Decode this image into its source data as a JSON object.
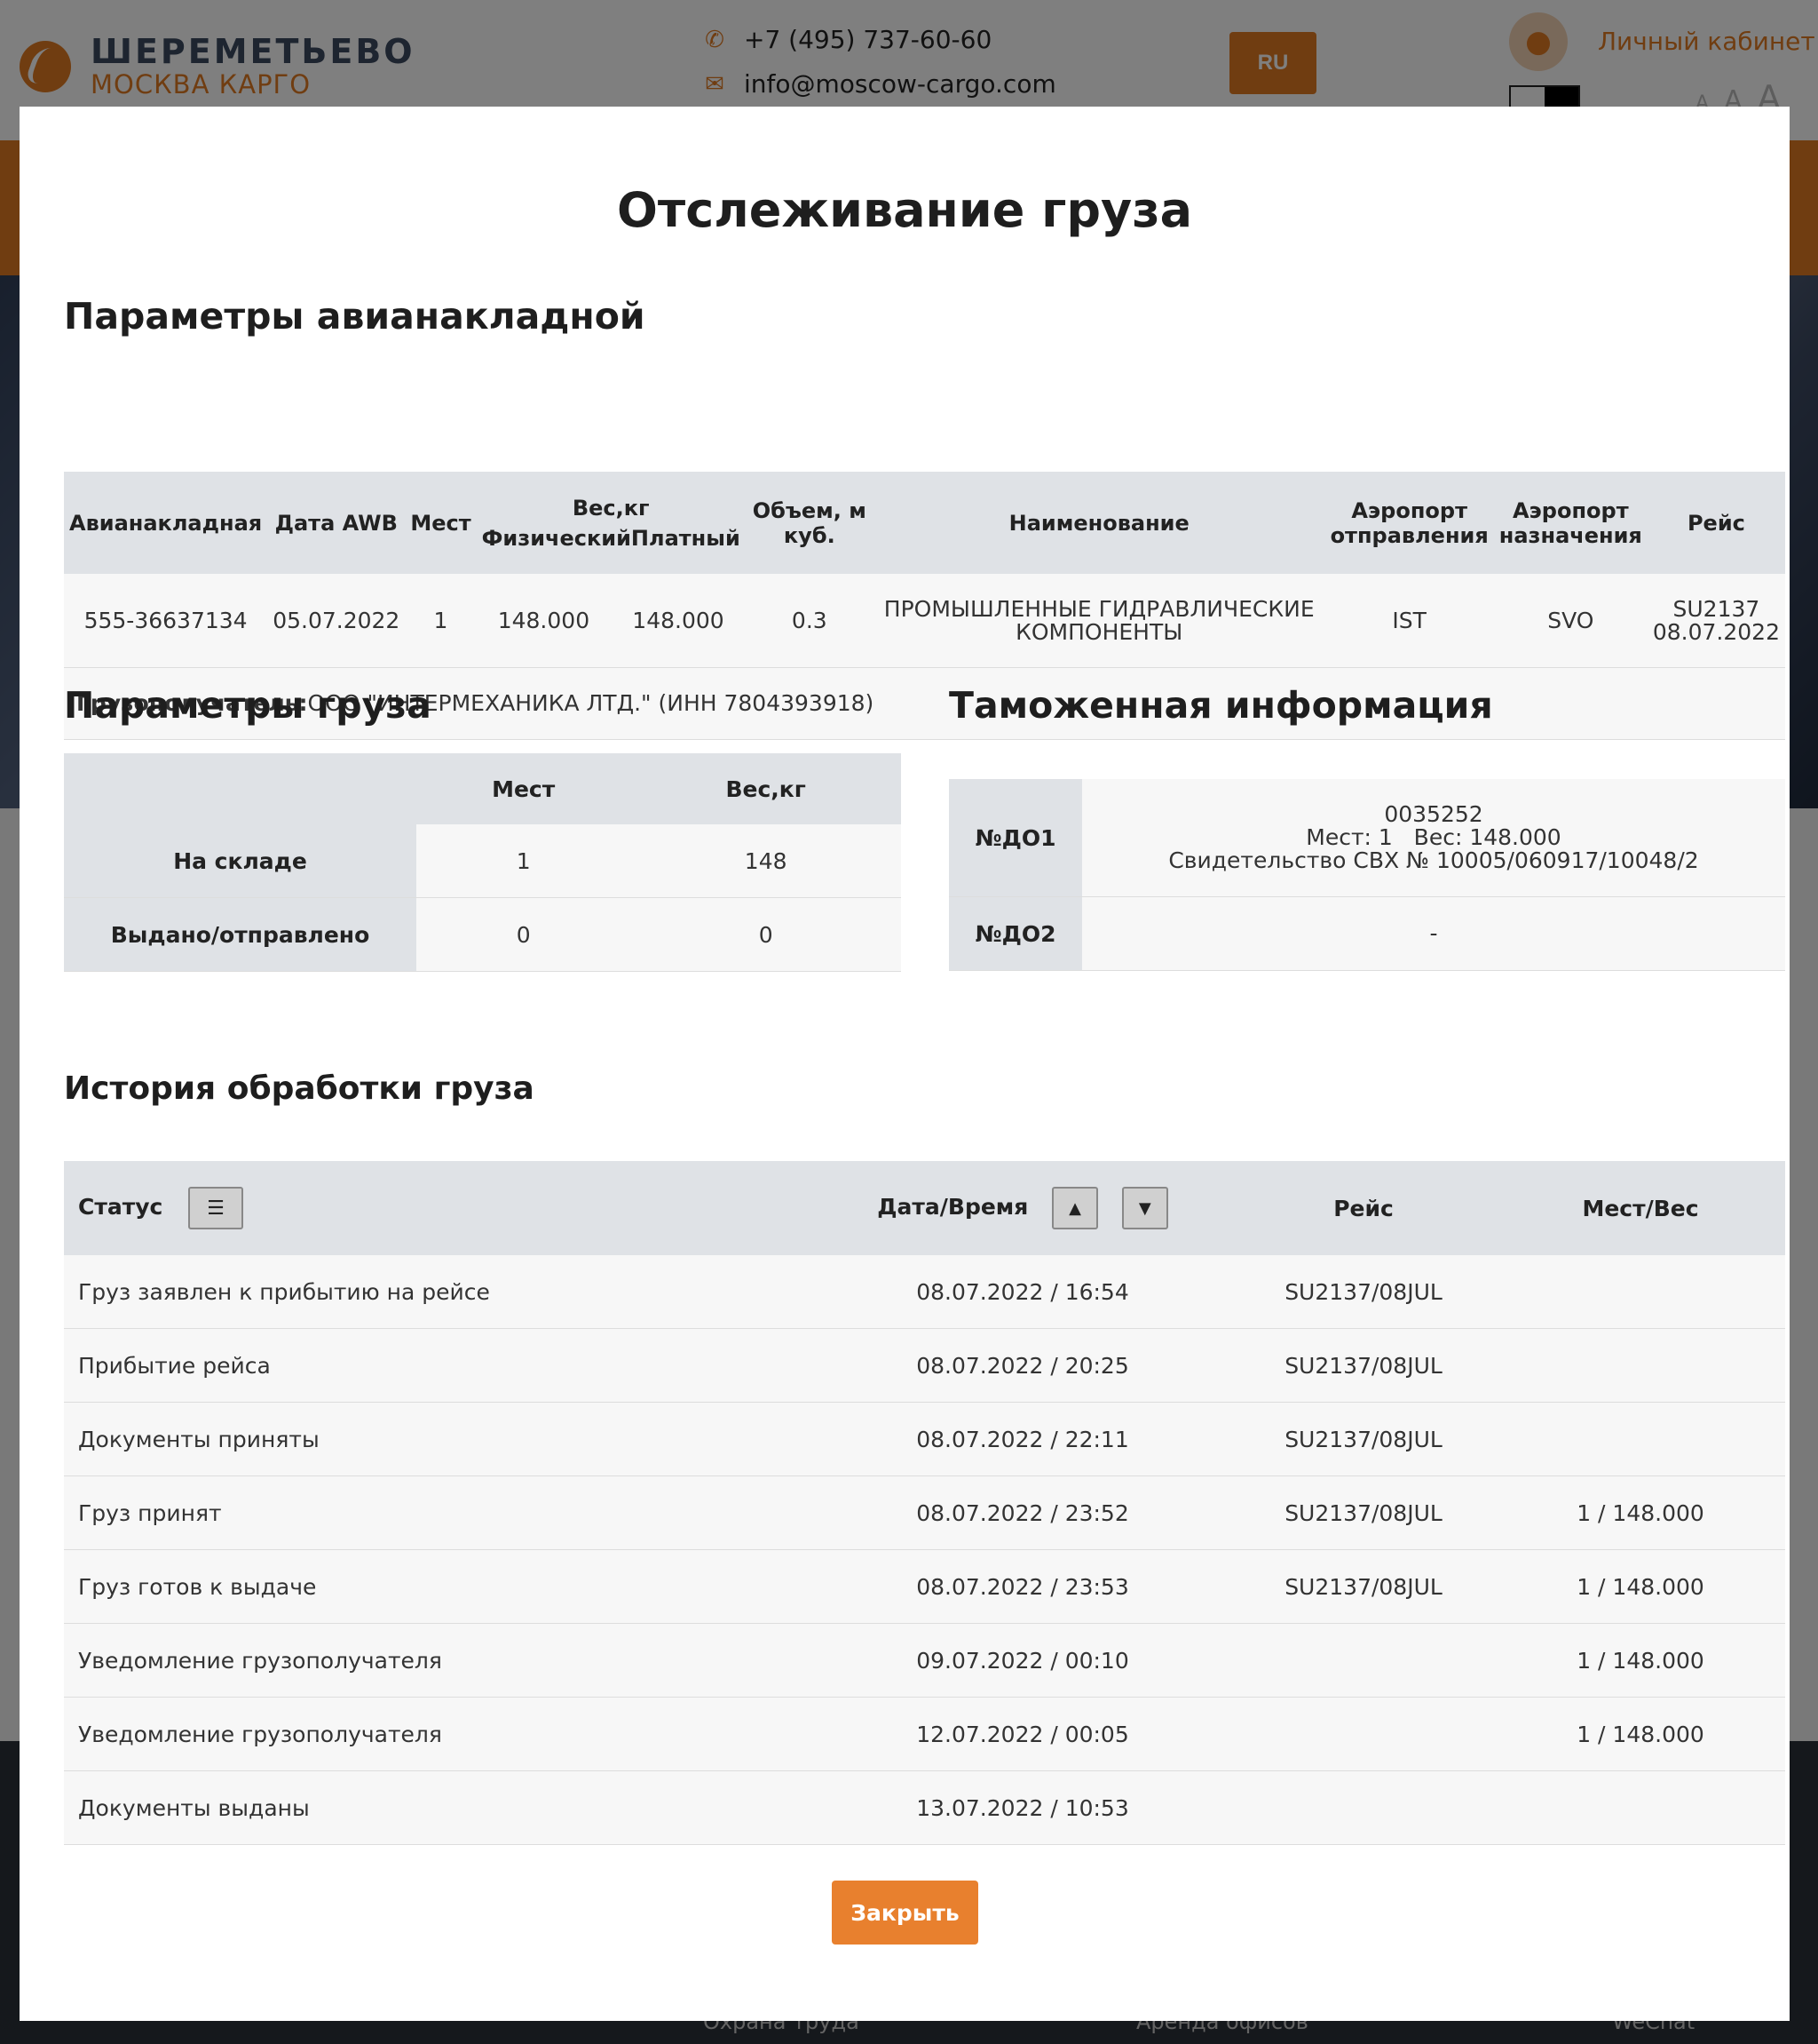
{
  "header": {
    "logo_title": "ШЕРЕМЕТЬЕВО",
    "logo_subtitle": "МОСКВА КАРГО",
    "phone": "+7 (495) 737-60-60",
    "email": "info@moscow-cargo.com",
    "lang_label": "RU",
    "cabinet_label": "Личный кабинет",
    "font_size_labels": [
      "A",
      "A",
      "A"
    ]
  },
  "footer_links": [
    "Охрана труда",
    "Аренда офисов",
    "WeChat"
  ],
  "modal": {
    "title": "Отслеживание груза",
    "awb_section_title": "Параметры авианакладной",
    "awb_headers": {
      "awb": "Авианакладная",
      "awb_date": "Дата AWB",
      "pieces": "Мест",
      "weight": "Вес,кг",
      "weight_physical": "Физический",
      "weight_paid": "Платный",
      "volume": "Объем, м куб.",
      "name": "Наименование",
      "origin": "Аэропорт отправления",
      "destination": "Аэропорт назначения",
      "flight": "Рейс"
    },
    "awb_row": {
      "awb": "555-36637134",
      "awb_date": "05.07.2022",
      "pieces": "1",
      "weight_physical": "148.000",
      "weight_paid": "148.000",
      "volume": "0.3",
      "name": "ПРОМЫШЛЕННЫЕ ГИДРАВЛИЧЕСКИЕ КОМПОНЕНТЫ",
      "origin": "IST",
      "destination": "SVO",
      "flight": "SU2137",
      "flight_date": "08.07.2022"
    },
    "consignee_label": "Грузополучатель:",
    "consignee_value": "ООО \"ИНТЕРМЕХАНИКА ЛТД.\" (ИНН 7804393918)",
    "cargo_section_title": "Параметры груза",
    "cargo_headers": {
      "pieces": "Мест",
      "weight": "Вес,кг"
    },
    "cargo_rows": [
      {
        "label": "На складе",
        "pieces": "1",
        "weight": "148"
      },
      {
        "label": "Выдано/отправлено",
        "pieces": "0",
        "weight": "0"
      }
    ],
    "customs_section_title": "Таможенная информация",
    "customs_rows": [
      {
        "label": "№ДО1",
        "line1": "0035252",
        "line2": "Мест: 1   Вес: 148.000",
        "line3": "Свидетельство СВХ № 10005/060917/10048/2"
      },
      {
        "label": "№ДО2",
        "line1": "-"
      }
    ],
    "history_section_title": "История обработки груза",
    "history_headers": {
      "status": "Статус",
      "datetime": "Дата/Время",
      "flight": "Рейс",
      "pieces_weight": "Мест/Вес"
    },
    "history_rows": [
      {
        "status": "Груз заявлен к прибытию на рейсе",
        "datetime": "08.07.2022 / 16:54",
        "flight": "SU2137/08JUL",
        "pieces_weight": ""
      },
      {
        "status": "Прибытие рейса",
        "datetime": "08.07.2022 / 20:25",
        "flight": "SU2137/08JUL",
        "pieces_weight": ""
      },
      {
        "status": "Документы приняты",
        "datetime": "08.07.2022 / 22:11",
        "flight": "SU2137/08JUL",
        "pieces_weight": ""
      },
      {
        "status": "Груз принят",
        "datetime": "08.07.2022 / 23:52",
        "flight": "SU2137/08JUL",
        "pieces_weight": "1 / 148.000"
      },
      {
        "status": "Груз готов к выдаче",
        "datetime": "08.07.2022 / 23:53",
        "flight": "SU2137/08JUL",
        "pieces_weight": "1 / 148.000"
      },
      {
        "status": "Уведомление грузополучателя",
        "datetime": "09.07.2022 / 00:10",
        "flight": "",
        "pieces_weight": "1 / 148.000"
      },
      {
        "status": "Уведомление грузополучателя",
        "datetime": "12.07.2022 / 00:05",
        "flight": "",
        "pieces_weight": "1 / 148.000"
      },
      {
        "status": "Документы выданы",
        "datetime": "13.07.2022 / 10:53",
        "flight": "",
        "pieces_weight": ""
      }
    ],
    "close_label": "Закрыть"
  },
  "colors": {
    "accent": "#e07a22",
    "header_gray": "#dfe2e6",
    "row_bg": "#f7f7f7"
  },
  "icons": {
    "phone": "phone-icon",
    "email": "email-icon",
    "user": "user-icon",
    "filter": "list-filter-icon",
    "sort_up": "sort-up-icon",
    "sort_down": "sort-down-icon"
  }
}
